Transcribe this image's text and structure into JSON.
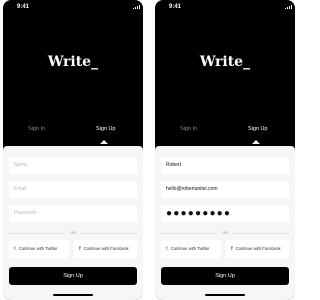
{
  "status": {
    "time": "9:41"
  },
  "logo": "Write_",
  "tabs": {
    "sign_in": "Sign In",
    "sign_up": "Sign Up"
  },
  "divider": "OR",
  "left": {
    "name_placeholder": "Name",
    "email_placeholder": "Email",
    "password_placeholder": "Password"
  },
  "right": {
    "name_value": "Robert",
    "email_value": "hello@robertanitei.com",
    "password_masked": "●●●●●●●●●"
  },
  "social": {
    "twitter": "Continue with Twitter",
    "facebook": "Continue with Facebook"
  },
  "icons": {
    "twitter": "t",
    "facebook": "f"
  },
  "primary_button": "Sign Up",
  "colors": {
    "background": "#000000",
    "sheet": "#f6f6f6",
    "twitter": "#1da1f2",
    "facebook": "#3b5998"
  }
}
